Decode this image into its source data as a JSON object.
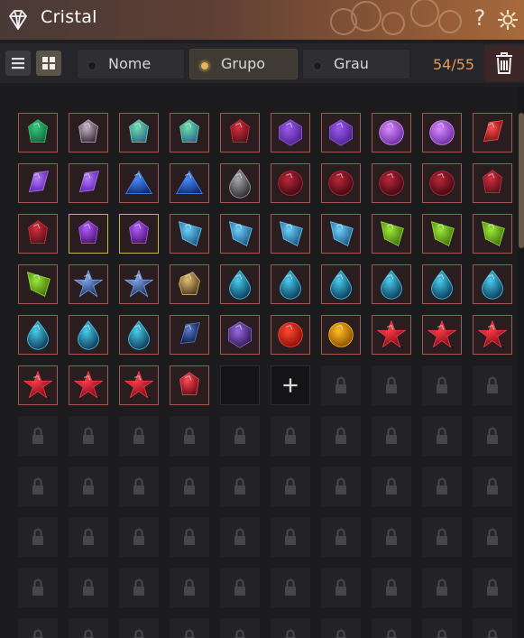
{
  "window": {
    "title": "Cristal",
    "help_label": "?"
  },
  "icons": {
    "title": "diamond-icon",
    "settings": "gear-icon",
    "list_view": "list-view-icon",
    "grid_view": "grid-view-icon",
    "trash": "trash-icon",
    "add": "plus-icon",
    "locked": "lock-icon"
  },
  "toolbar": {
    "sort_options": [
      {
        "label": "Nome",
        "selected": false
      },
      {
        "label": "Grupo",
        "selected": true
      },
      {
        "label": "Grau",
        "selected": false
      }
    ],
    "count": "54/55",
    "active_view": "grid"
  },
  "colors": {
    "accent": "#e39a57",
    "selected_dot": "#e5b45c",
    "item_border": "#a35a52",
    "item_border_highlight": "#c9b25a"
  },
  "inventory": {
    "slots": [
      "emerald-green",
      "dark-crystal",
      "teal-blue-crystal",
      "teal-blue-crystal",
      "red-dark-gem",
      "amethyst-hex",
      "amethyst-hex",
      "amethyst-round",
      "amethyst-round",
      "red-shard",
      "violet-shard",
      "violet-shard",
      "blue-triangle",
      "blue-triangle",
      "dark-teardrop",
      "red-round-dark",
      "red-round-dark",
      "red-round-dark",
      "red-round-dark",
      "red-dark-gem",
      "red-dark-gem",
      "purple-gem",
      "purple-gem",
      "cyan-kite",
      "cyan-kite",
      "cyan-kite",
      "cyan-kite",
      "green-kite",
      "green-kite",
      "green-kite",
      "green-kite",
      "blue-star-crystal",
      "blue-star-crystal",
      "gold-cube",
      "aqua-drop",
      "aqua-drop",
      "aqua-drop",
      "aqua-drop",
      "aqua-drop",
      "aqua-drop",
      "aqua-drop",
      "aqua-drop",
      "aqua-drop",
      "navy-shards",
      "violet-octahedron",
      "red-orb",
      "gold-orb",
      "red-star",
      "red-star",
      "red-star",
      "red-star",
      "red-star",
      "red-star",
      "ruby-red",
      "empty",
      "add",
      "locked",
      "locked",
      "locked",
      "locked",
      "locked",
      "locked",
      "locked",
      "locked",
      "locked",
      "locked",
      "locked",
      "locked",
      "locked",
      "locked",
      "locked",
      "locked",
      "locked",
      "locked",
      "locked",
      "locked",
      "locked",
      "locked",
      "locked",
      "locked",
      "locked",
      "locked",
      "locked",
      "locked",
      "locked",
      "locked",
      "locked",
      "locked",
      "locked",
      "locked",
      "locked",
      "locked",
      "locked",
      "locked",
      "locked",
      "locked",
      "locked",
      "locked",
      "locked",
      "locked",
      "locked",
      "locked",
      "locked",
      "locked",
      "locked",
      "locked",
      "locked",
      "locked",
      "locked",
      "locked"
    ],
    "highlighted_slots": [
      21,
      22
    ]
  }
}
